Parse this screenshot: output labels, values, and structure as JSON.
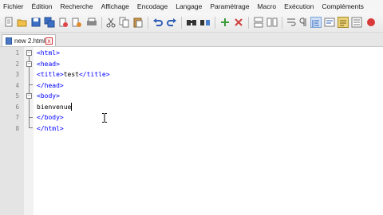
{
  "menu": {
    "items": [
      {
        "label": "Fichier"
      },
      {
        "label": "Édition"
      },
      {
        "label": "Recherche"
      },
      {
        "label": "Affichage"
      },
      {
        "label": "Encodage"
      },
      {
        "label": "Langage"
      },
      {
        "label": "Paramétrage"
      },
      {
        "label": "Macro"
      },
      {
        "label": "Exécution"
      },
      {
        "label": "Compléments"
      }
    ]
  },
  "toolbar": {
    "icons": [
      "new-file-icon",
      "open-file-icon",
      "save-icon",
      "save-all-icon",
      "close-icon",
      "close-all-icon",
      "print-icon",
      "cut-icon",
      "copy-icon",
      "paste-icon",
      "undo-icon",
      "redo-icon",
      "find-icon",
      "replace-icon",
      "zoom-in-icon",
      "zoom-out-icon",
      "sync-vertical-icon",
      "sync-horizontal-icon",
      "word-wrap-icon",
      "show-all-chars-icon",
      "indent-guide-icon",
      "language-icon",
      "doc-map-icon",
      "function-list-icon",
      "record-macro-icon"
    ]
  },
  "tabs": [
    {
      "label": "new 2.html",
      "close": "x"
    }
  ],
  "editor": {
    "lines": [
      {
        "num": "1",
        "fold": "−",
        "tag": "<html>",
        "text": ""
      },
      {
        "num": "2",
        "fold": "−",
        "tag": "<head>",
        "text": ""
      },
      {
        "num": "3",
        "fold": "",
        "tag": "<title>",
        "text": "test",
        "close": "</title>"
      },
      {
        "num": "4",
        "fold": "",
        "tag": "</head>",
        "text": ""
      },
      {
        "num": "5",
        "fold": "−",
        "tag": "<body>",
        "text": ""
      },
      {
        "num": "6",
        "fold": "",
        "tag": "",
        "text": "bienvenue"
      },
      {
        "num": "7",
        "fold": "",
        "tag": "</body>",
        "text": ""
      },
      {
        "num": "8",
        "fold": "",
        "tag": "</html>",
        "text": ""
      }
    ]
  }
}
